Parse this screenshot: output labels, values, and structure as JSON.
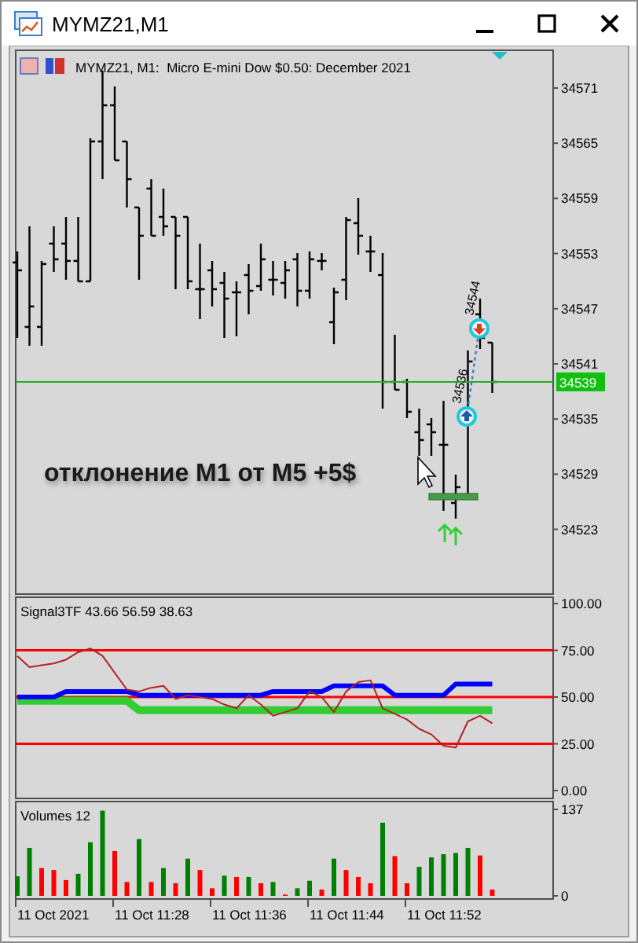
{
  "window": {
    "title": "MYMZ21,M1"
  },
  "chart": {
    "legend": "MYMZ21, M1:  Micro E-mini Dow $0.50: December 2021",
    "price_axis": [
      "34571",
      "34565",
      "34559",
      "34553",
      "34547",
      "34541",
      "34535",
      "34529",
      "34523"
    ],
    "current_price": "34539",
    "annotation": "отклонение M1 от M5 +5$",
    "trades": [
      {
        "kind": "buy",
        "price": "34536"
      },
      {
        "kind": "sell",
        "price": "34544"
      }
    ]
  },
  "signal_panel": {
    "title": "Signal3TF 43.66 56.59 38.63",
    "chart_data": {
      "type": "line",
      "ylim": [
        -4.2,
        103.4
      ],
      "grid": true,
      "yticks": [
        {
          "value": 100,
          "label": "100.00"
        },
        {
          "value": 75,
          "label": "75.00"
        },
        {
          "value": 50,
          "label": "50.00"
        },
        {
          "value": 25,
          "label": "25.00"
        },
        {
          "value": 0,
          "label": "0.00"
        }
      ],
      "series": [
        {
          "color": "#32cd32",
          "values": [
            48,
            48,
            48,
            48,
            48,
            48,
            48,
            48,
            48,
            48,
            43,
            43,
            43,
            43,
            43,
            43,
            43,
            43,
            43,
            43,
            43,
            43,
            43,
            43,
            43,
            43,
            43,
            43,
            43,
            43,
            43,
            43,
            43,
            43,
            43,
            43,
            43,
            43,
            43,
            43
          ]
        },
        {
          "color": "#0000ff",
          "values": [
            50,
            50,
            50,
            50,
            53,
            53,
            53,
            53,
            53,
            53,
            51,
            51,
            51,
            51,
            51,
            51,
            51,
            51,
            51,
            51,
            51,
            53,
            53,
            53,
            53,
            53,
            56,
            56,
            56,
            56,
            56,
            51,
            51,
            51,
            51,
            51,
            57,
            57,
            57,
            57
          ]
        },
        {
          "color": "#b22222",
          "values": [
            72,
            66,
            67,
            68,
            70,
            74,
            76,
            72,
            63,
            54,
            53,
            55,
            56,
            49,
            51,
            50,
            49,
            46,
            44,
            51,
            46,
            40,
            42,
            44,
            53,
            50,
            42,
            53,
            58,
            59,
            44,
            41,
            38,
            33,
            30,
            24,
            23,
            37,
            40,
            36
          ]
        }
      ]
    }
  },
  "volume_panel": {
    "title": "Volumes 12",
    "chart_data": {
      "type": "bar",
      "ylim": [
        0,
        137
      ],
      "yticks": [
        {
          "value": 137,
          "label": "137"
        },
        {
          "value": 0,
          "label": "0"
        }
      ],
      "series": [
        {
          "color": "#008000",
          "values": [
            31,
            76,
            null,
            null,
            null,
            35,
            85,
            135,
            null,
            null,
            90,
            null,
            44,
            null,
            59,
            null,
            null,
            32,
            null,
            30,
            null,
            22,
            null,
            12,
            24,
            null,
            59,
            null,
            null,
            null,
            116,
            null,
            null,
            46,
            61,
            66,
            68,
            76,
            null,
            null
          ]
        },
        {
          "color": "#ff0000",
          "values": [
            null,
            null,
            44,
            41,
            25,
            null,
            null,
            null,
            71,
            22,
            null,
            22,
            null,
            20,
            null,
            41,
            12,
            null,
            30,
            null,
            20,
            null,
            2,
            null,
            null,
            10,
            null,
            41,
            30,
            20,
            null,
            63,
            20,
            null,
            null,
            null,
            null,
            null,
            64,
            10
          ]
        }
      ]
    }
  },
  "time_axis": [
    "11 Oct 2021",
    "11 Oct 11:28",
    "11 Oct 11:36",
    "11 Oct 11:44",
    "11 Oct 11:52"
  ]
}
